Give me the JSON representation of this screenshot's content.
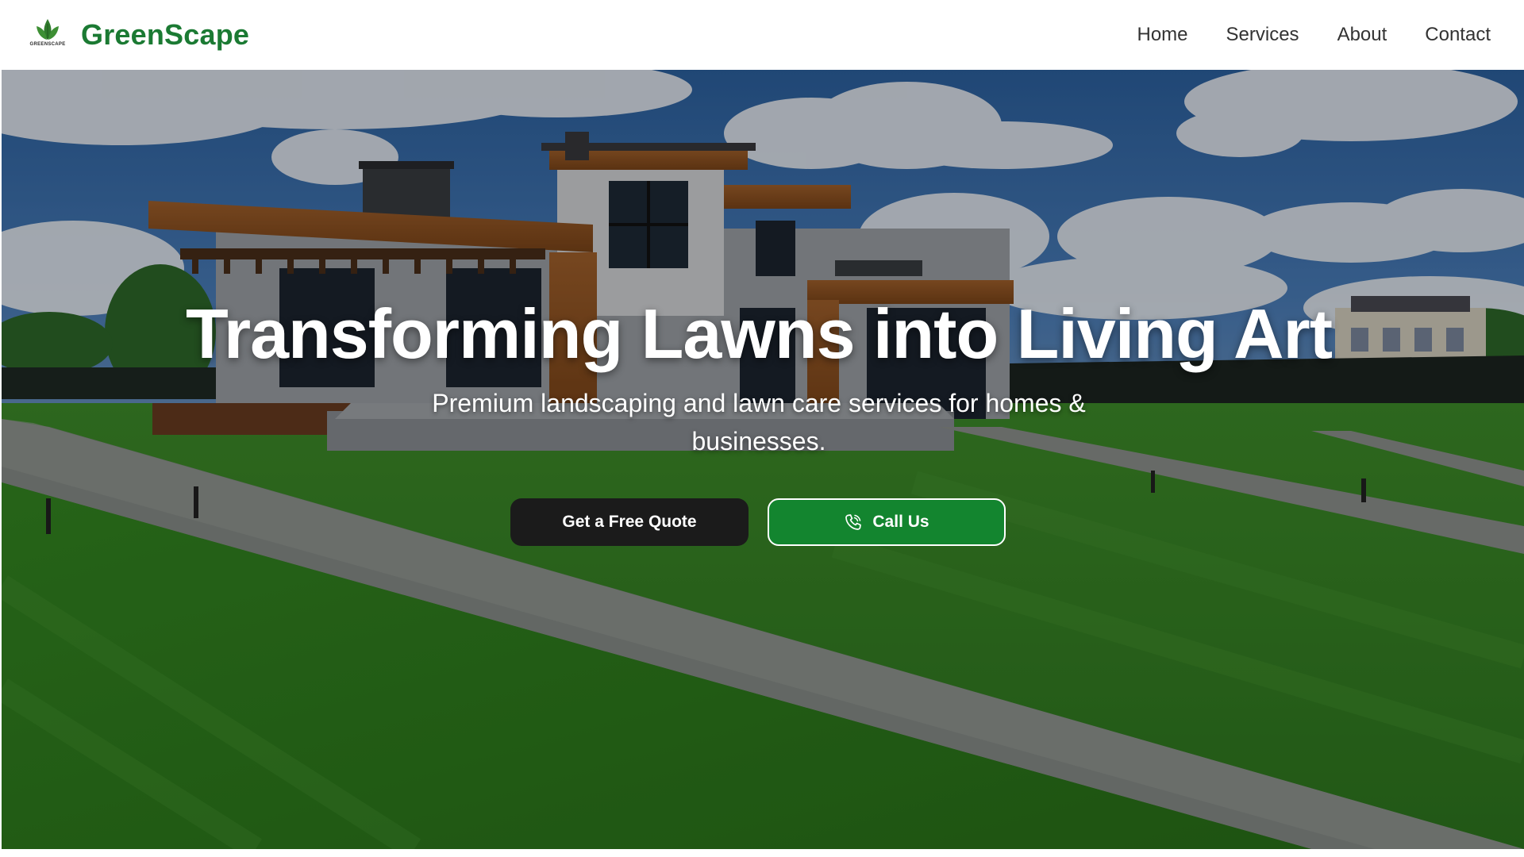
{
  "header": {
    "logo_caption": "GREENSCAPE",
    "brand_name": "GreenScape",
    "brand_color": "#1b7a33",
    "nav": [
      {
        "label": "Home"
      },
      {
        "label": "Services"
      },
      {
        "label": "About"
      },
      {
        "label": "Contact"
      }
    ]
  },
  "hero": {
    "title": "Transforming Lawns into Living Art",
    "subtitle": "Premium landscaping and lawn care services for homes & businesses.",
    "buttons": {
      "quote_label": "Get a Free Quote",
      "call_label": "Call Us",
      "call_icon": "phone-icon"
    },
    "colors": {
      "quote_button": "#1b1b1b",
      "call_button": "#13852f"
    }
  }
}
